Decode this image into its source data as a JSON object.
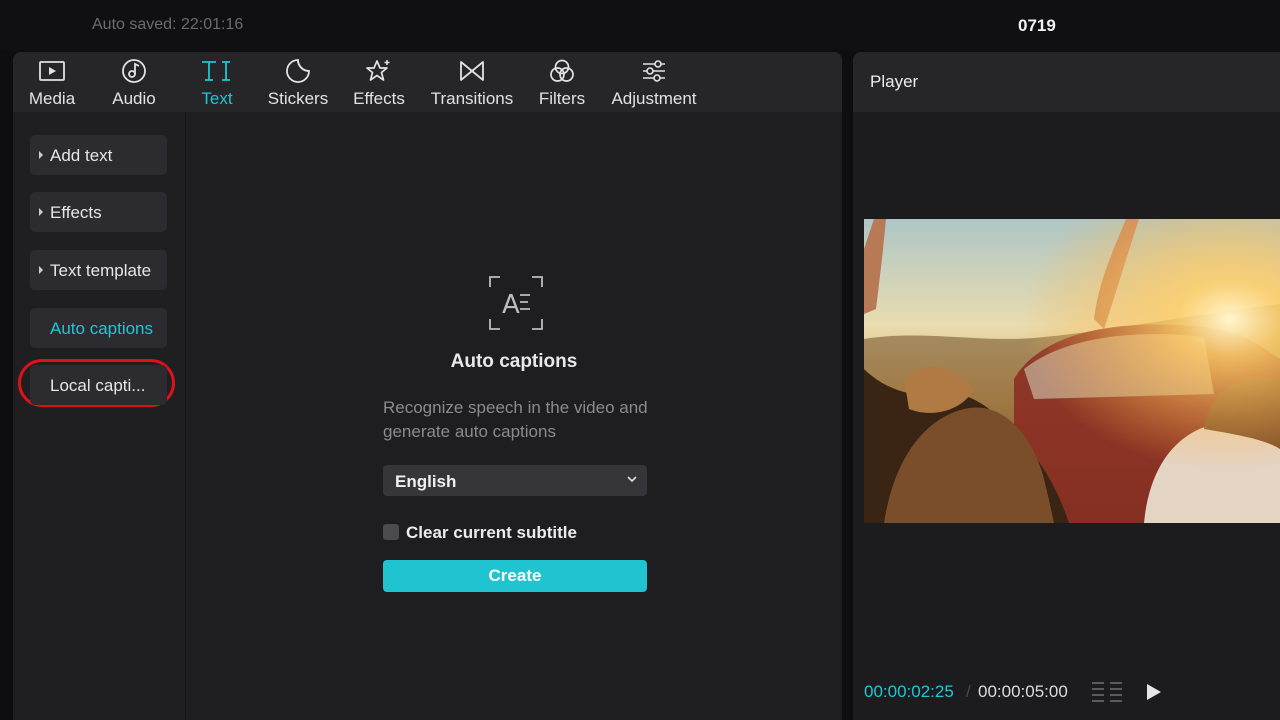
{
  "topbar": {
    "autosaved": "Auto saved: 22:01:16",
    "project_name": "0719"
  },
  "toolbar": {
    "tabs": [
      {
        "label": "Media",
        "icon": "media-icon"
      },
      {
        "label": "Audio",
        "icon": "audio-icon"
      },
      {
        "label": "Text",
        "icon": "text-icon",
        "active": true
      },
      {
        "label": "Stickers",
        "icon": "stickers-icon"
      },
      {
        "label": "Effects",
        "icon": "effects-icon"
      },
      {
        "label": "Transitions",
        "icon": "transitions-icon"
      },
      {
        "label": "Filters",
        "icon": "filters-icon"
      },
      {
        "label": "Adjustment",
        "icon": "adjustment-icon"
      }
    ]
  },
  "sidebar": {
    "items": [
      {
        "label": "Add text"
      },
      {
        "label": "Effects"
      },
      {
        "label": "Text template"
      },
      {
        "label": "Auto captions",
        "active": true
      },
      {
        "label": "Local capti..."
      }
    ]
  },
  "auto_captions": {
    "icon": "auto-captions-icon",
    "title": "Auto captions",
    "description": "Recognize speech in the video and generate auto captions",
    "language": "English",
    "clear_label": "Clear current subtitle",
    "clear_checked": false,
    "create_label": "Create"
  },
  "player": {
    "title": "Player",
    "current_time": "00:00:02:25",
    "separator": "/",
    "total_time": "00:00:05:00"
  },
  "colors": {
    "accent": "#1fc7d4",
    "highlight_ring": "#e0101a",
    "create_button": "#20c4d0"
  }
}
